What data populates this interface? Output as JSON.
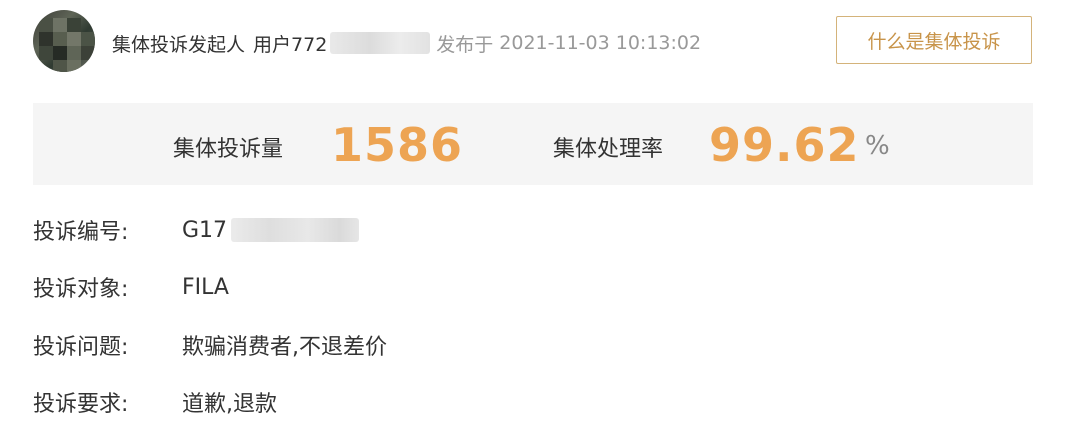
{
  "header": {
    "initiator_label": "集体投诉发起人",
    "username": "用户772",
    "published_label": "发布于",
    "published_time": "2021-11-03 10:13:02",
    "help_button_label": "什么是集体投诉"
  },
  "stats": {
    "count_label": "集体投诉量",
    "count_value": "1586",
    "rate_label": "集体处理率",
    "rate_value": "99.62",
    "rate_unit": "%"
  },
  "fields": [
    {
      "label": "投诉编号:",
      "value": "G17"
    },
    {
      "label": "投诉对象:",
      "value": "FILA"
    },
    {
      "label": "投诉问题:",
      "value": "欺骗消费者,不退差价"
    },
    {
      "label": "投诉要求:",
      "value": "道歉,退款"
    }
  ],
  "colors": {
    "accent_orange": "#eda453",
    "button_border": "#d4b37a",
    "button_text": "#c8944a",
    "stats_background": "#f5f5f5",
    "muted_text": "#999999"
  }
}
